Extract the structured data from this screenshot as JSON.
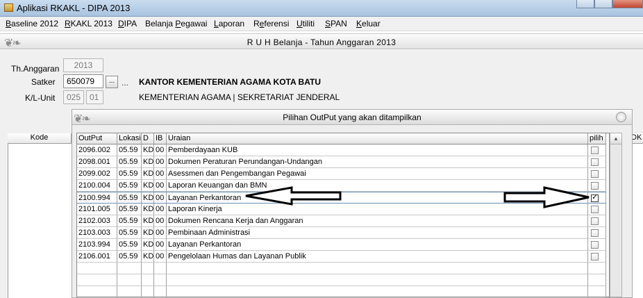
{
  "window": {
    "title": "Aplikasi RKAKL - DIPA 2013"
  },
  "menu": [
    {
      "label": "Baseline 2012",
      "key": "B"
    },
    {
      "label": "RKAKL 2013",
      "key": "R"
    },
    {
      "label": "DIPA",
      "key": "D"
    },
    {
      "label": "Belanja Pegawai",
      "key": "P"
    },
    {
      "label": "Laporan",
      "key": "L"
    },
    {
      "label": "Referensi",
      "key": "e"
    },
    {
      "label": "Utiliti",
      "key": "U"
    },
    {
      "label": "SPAN",
      "key": "S"
    },
    {
      "label": "Keluar",
      "key": "K"
    }
  ],
  "form": {
    "title": "R U H Belanja  -  Tahun Anggaran 2013",
    "th_label": "Th.Anggaran",
    "th_value": "2013",
    "satker_label": "Satker",
    "satker_value": "650079",
    "browse_label": "...",
    "ellipsis": "...",
    "satker_name": "KANTOR KEMENTERIAN AGAMA KOTA BATU",
    "klunit_label": "K/L-Unit",
    "kl_value": "025",
    "unit_value": "01",
    "kl_name": "KEMENTERIAN AGAMA | SEKRETARIAT JENDERAL",
    "bg_col_kode": "Kode",
    "bg_col_dk": "DK"
  },
  "dialog": {
    "title": "Pilihan OutPut yang akan ditampilkan",
    "columns": [
      "OutPut",
      "Lokasi",
      "D",
      "IB",
      "Uraian",
      "pilih"
    ],
    "rows": [
      {
        "output": "2096.002",
        "lokasi": "05.59",
        "d": "KD",
        "ib": "00",
        "uraian": "Pemberdayaan KUB",
        "pilih": false
      },
      {
        "output": "2098.001",
        "lokasi": "05.59",
        "d": "KD",
        "ib": "00",
        "uraian": "Dokumen Peraturan Perundangan-Undangan",
        "pilih": false
      },
      {
        "output": "2099.002",
        "lokasi": "05.59",
        "d": "KD",
        "ib": "00",
        "uraian": "Asessmen dan Pengembangan Pegawai",
        "pilih": false
      },
      {
        "output": "2100.004",
        "lokasi": "05.59",
        "d": "KD",
        "ib": "00",
        "uraian": "Laporan Keuangan dan BMN",
        "pilih": false
      },
      {
        "output": "2100.994",
        "lokasi": "05.59",
        "d": "KD",
        "ib": "00",
        "uraian": "Layanan Perkantoran",
        "pilih": true
      },
      {
        "output": "2101.005",
        "lokasi": "05.59",
        "d": "KD",
        "ib": "00",
        "uraian": "Laporan Kinerja",
        "pilih": false
      },
      {
        "output": "2102.003",
        "lokasi": "05.59",
        "d": "KD",
        "ib": "00",
        "uraian": "Dokumen Rencana Kerja dan Anggaran",
        "pilih": false
      },
      {
        "output": "2103.003",
        "lokasi": "05.59",
        "d": "KD",
        "ib": "00",
        "uraian": "Pembinaan Administrasi",
        "pilih": false
      },
      {
        "output": "2103.994",
        "lokasi": "05.59",
        "d": "KD",
        "ib": "00",
        "uraian": "Layanan Perkantoran",
        "pilih": false
      },
      {
        "output": "2106.001",
        "lokasi": "05.59",
        "d": "KD",
        "ib": "00",
        "uraian": "Pengelolaan Humas dan Layanan Publik",
        "pilih": false
      }
    ],
    "selected_row": 4
  }
}
